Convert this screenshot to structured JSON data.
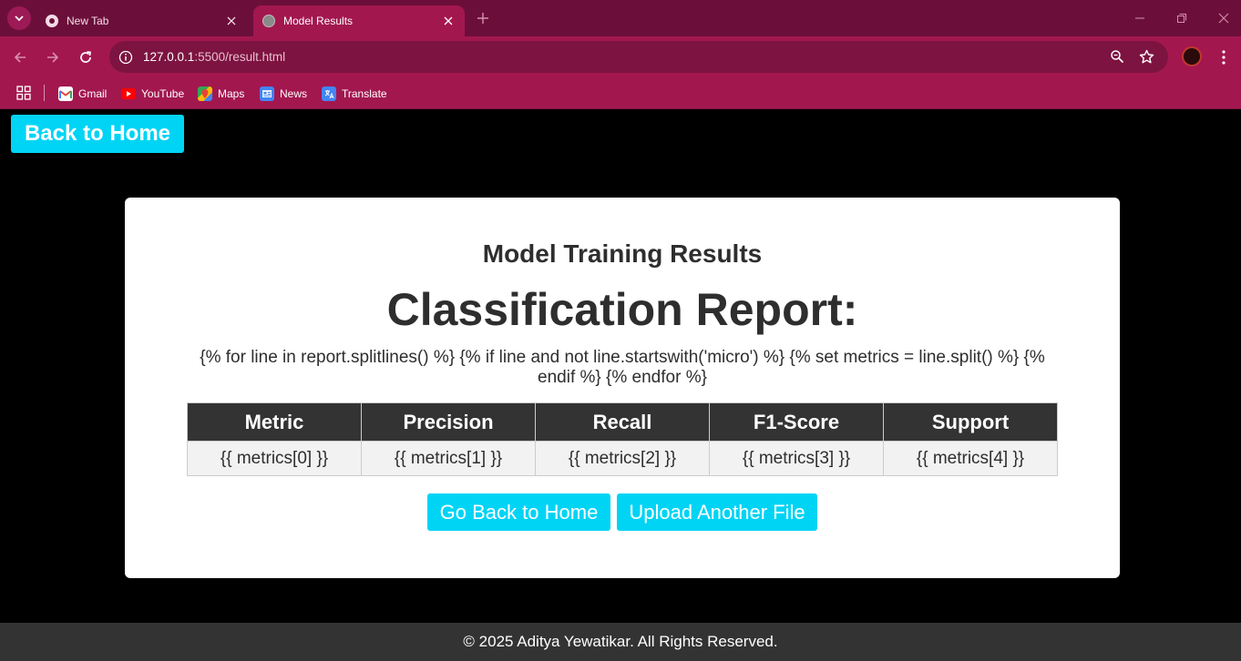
{
  "browser": {
    "tabs": [
      {
        "title": "New Tab",
        "active": false
      },
      {
        "title": "Model Results",
        "active": true
      }
    ],
    "url_host": "127.0.0.1",
    "url_rest": ":5500/result.html",
    "bookmarks": [
      {
        "label": "Gmail",
        "icon": "gmail-icon"
      },
      {
        "label": "YouTube",
        "icon": "youtube-icon"
      },
      {
        "label": "Maps",
        "icon": "maps-icon"
      },
      {
        "label": "News",
        "icon": "news-icon"
      },
      {
        "label": "Translate",
        "icon": "translate-icon"
      }
    ]
  },
  "page": {
    "back_top_label": "Back to Home",
    "subtitle": "Model Training Results",
    "title": "Classification Report:",
    "template_text": "{% for line in report.splitlines() %} {% if line and not line.startswith('micro') %} {% set metrics = line.split() %} {% endif %} {% endfor %}",
    "table": {
      "headers": [
        "Metric",
        "Precision",
        "Recall",
        "F1-Score",
        "Support"
      ],
      "row": [
        "{{ metrics[0] }}",
        "{{ metrics[1] }}",
        "{{ metrics[2] }}",
        "{{ metrics[3] }}",
        "{{ metrics[4] }}"
      ]
    },
    "buttons": {
      "go_back": "Go Back to Home",
      "upload": "Upload Another File"
    },
    "footer": "© 2025 Aditya Yewatikar. All Rights Reserved."
  },
  "colors": {
    "tabbar": "#6b0f3a",
    "toolbar": "#a3174f",
    "accent_button": "#00d4f5",
    "table_header": "#333333",
    "footer": "#333333"
  }
}
